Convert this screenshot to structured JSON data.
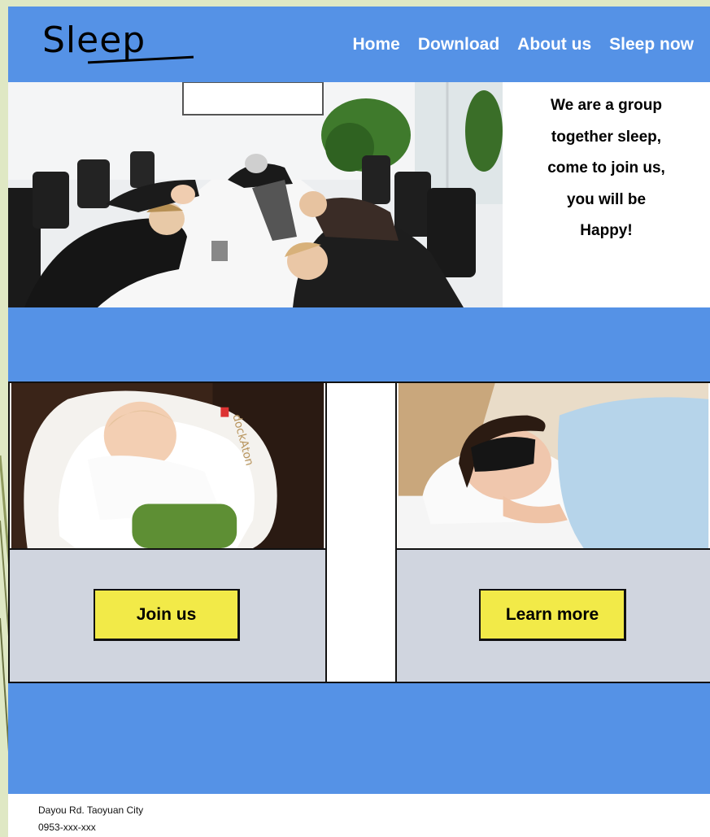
{
  "header": {
    "logo": "Sleep",
    "nav": [
      "Home",
      "Download",
      "About us",
      "Sleep now"
    ]
  },
  "hero": {
    "lines": [
      "We are a group",
      "together sleep,",
      "come to join us,",
      "you will be",
      "Happy!"
    ],
    "image": "office-meeting-people-sleeping-photo"
  },
  "cards": [
    {
      "image": "baby-sleeping-photo",
      "button": "Join us"
    },
    {
      "image": "woman-sleeping-eye-mask-photo",
      "button": "Learn more"
    }
  ],
  "footer": {
    "address": "Dayou Rd. Taoyuan City",
    "phone": "0953-xxx-xxx"
  },
  "colors": {
    "header_blue": "#5592e6",
    "button_yellow": "#f2ea48",
    "card_gray": "#d0d5df",
    "page_bg": "#dfe8c4"
  }
}
